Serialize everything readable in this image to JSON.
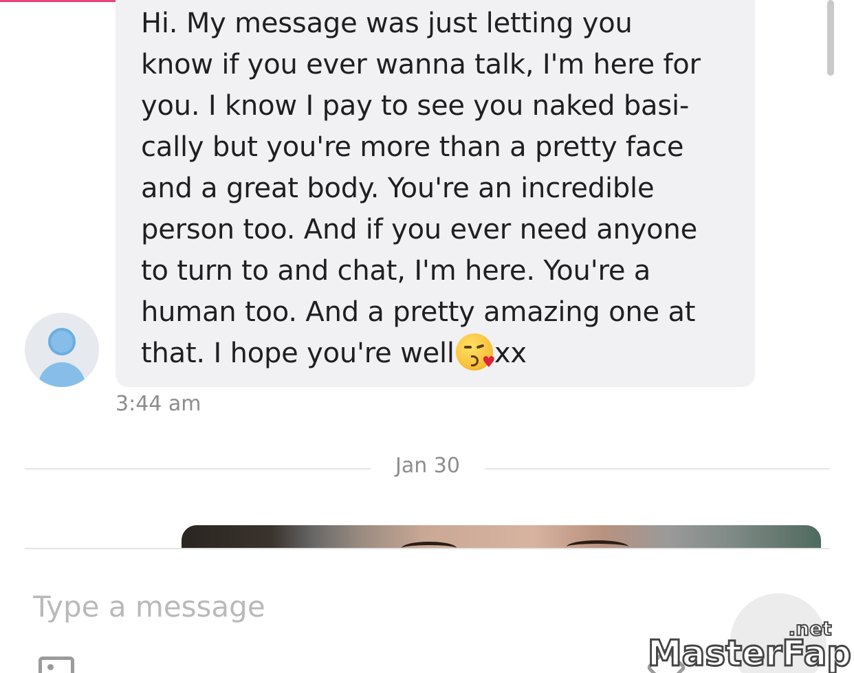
{
  "conversation": {
    "received_message": {
      "text": "Hi. My message was just letting you\nknow if you ever wanna talk, I'm here for\nyou. I know I pay to see you naked basi-\ncally but you're more than a pretty face\nand a great body. You're an incredible\nperson too. And if you ever need anyone\nto turn to and chat, I'm here. You're a\nhuman too. And a pretty amazing one at\nthat. I hope you're well",
      "emoji": "kissing-face-with-heart-emoji",
      "text_after_emoji": "xx",
      "time": "3:44 am"
    },
    "date_divider": "Jan 30",
    "next_message": {
      "type": "photo"
    }
  },
  "composer": {
    "placeholder": "Type a message"
  },
  "icons": {
    "avatar": "user-avatar-icon",
    "attach": "image-attach-icon",
    "price": "price-tag-icon",
    "send": "send-icon"
  },
  "watermark": {
    "text": "MasterFap",
    "suffix": ".net"
  },
  "colors": {
    "accent": "#e8457a",
    "bubble_bg": "#f1f1f3",
    "avatar_blue": "#86bee9",
    "muted_text": "#8d8d8d"
  }
}
